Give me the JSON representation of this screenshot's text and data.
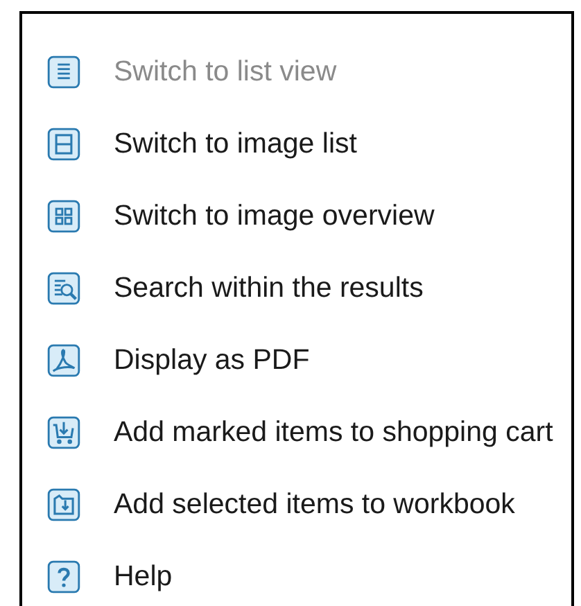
{
  "menu": {
    "items": [
      {
        "label": "Switch to list view",
        "kind": "list",
        "disabled": true
      },
      {
        "label": "Switch to image list",
        "kind": "rows",
        "disabled": false
      },
      {
        "label": "Switch to image overview",
        "kind": "grid",
        "disabled": false
      },
      {
        "label": "Search within the results",
        "kind": "search",
        "disabled": false
      },
      {
        "label": "Display as PDF",
        "kind": "pdf",
        "disabled": false
      },
      {
        "label": "Add marked items to shopping cart",
        "kind": "cart",
        "disabled": false
      },
      {
        "label": "Add selected items to workbook",
        "kind": "folder",
        "disabled": false
      },
      {
        "label": "Help",
        "kind": "help",
        "disabled": false
      }
    ]
  }
}
